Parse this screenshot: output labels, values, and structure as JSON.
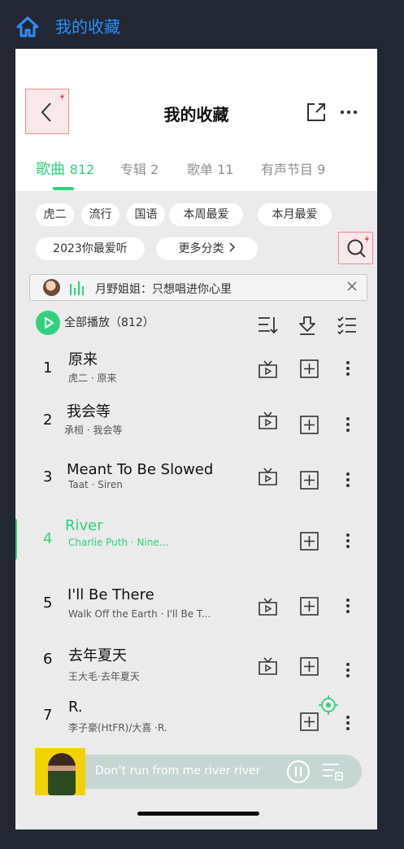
{
  "app": {
    "title": "我的收藏"
  },
  "header": {
    "title": "我的收藏"
  },
  "tabs": [
    {
      "label": "歌曲",
      "count": "812"
    },
    {
      "label": "专辑 2"
    },
    {
      "label": "歌单 11"
    },
    {
      "label": "有声节目 9"
    }
  ],
  "chips": [
    "虎二",
    "流行",
    "国语",
    "本周最爱",
    "本月最爱",
    "2023你最爱听",
    "更多分类"
  ],
  "banner": {
    "text": "月野姐姐：只想唱进你心里"
  },
  "playall": {
    "label": "全部播放（812）"
  },
  "songs": [
    {
      "num": "1",
      "title": "原来",
      "sub": "虎二 · 原来"
    },
    {
      "num": "2",
      "title": "我会等",
      "sub": "承桓 · 我会等"
    },
    {
      "num": "3",
      "title": "Meant To Be Slowed",
      "sub": "Taat · Siren"
    },
    {
      "num": "4",
      "title": "River",
      "sub": "Charlie Puth · Nine..."
    },
    {
      "num": "5",
      "title": "I'll Be There",
      "sub": "Walk Off the Earth · I'll Be T..."
    },
    {
      "num": "6",
      "title": "去年夏天",
      "sub": "王大毛·去年夏天"
    },
    {
      "num": "7",
      "title": "R.",
      "sub": "李子豪(HtFR)/大喜 ·R."
    }
  ],
  "player": {
    "lyric": "Don’t run from me river river"
  },
  "colors": {
    "accent": "#2ed17c",
    "link": "#2c8ef8",
    "highlight": "#f08a94"
  },
  "icons": [
    "home-icon",
    "back-icon",
    "share-icon",
    "more-icon",
    "search-icon",
    "sort-icon",
    "download-icon",
    "multi-select-icon",
    "mv-icon",
    "add-icon",
    "locate-icon",
    "pause-icon",
    "queue-icon"
  ]
}
